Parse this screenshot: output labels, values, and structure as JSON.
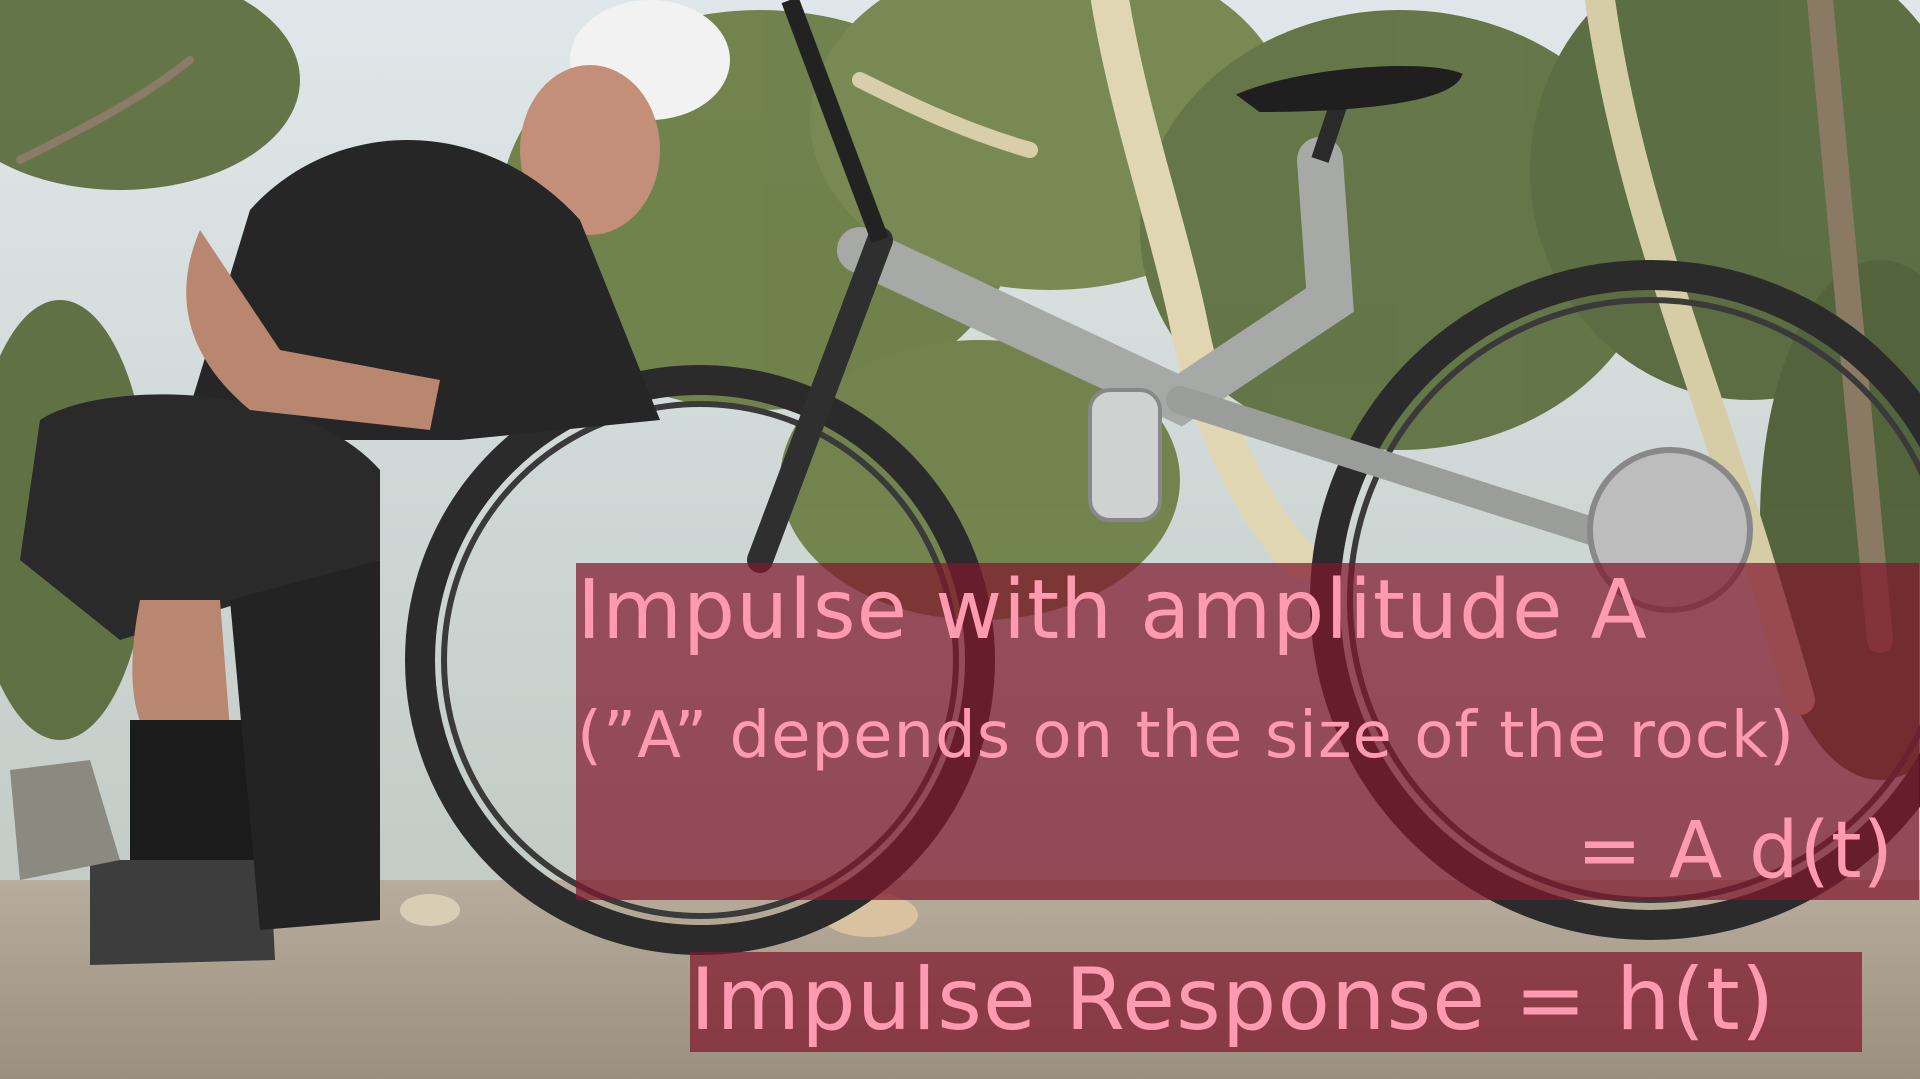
{
  "captions": {
    "line1": "Impulse with amplitude A",
    "line2": "(”A” depends on the size of the rock)",
    "line3": "= A d(t)",
    "line4": "Impulse Response = h(t)"
  },
  "colors": {
    "caption_box": "#80182c",
    "caption_text": "#ff9ab0"
  }
}
